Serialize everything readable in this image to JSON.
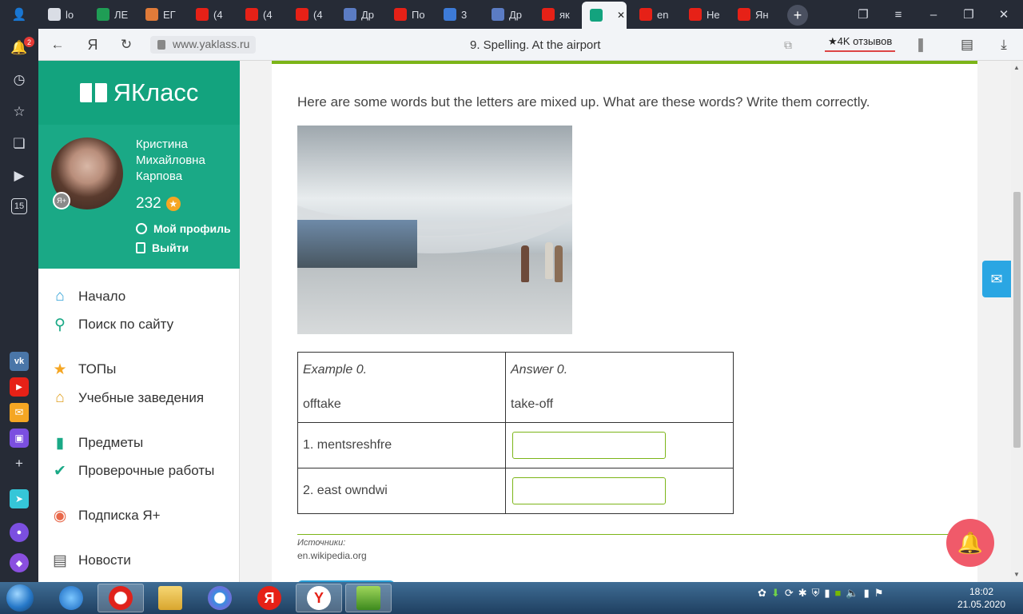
{
  "browser": {
    "tabs": [
      {
        "label": "lo",
        "icon": "document-icon",
        "color": "#d9dde5"
      },
      {
        "label": "ЛЕ",
        "icon": "green-cross-icon",
        "color": "#1f9d55"
      },
      {
        "label": "ЕГ",
        "icon": "basketball-icon",
        "color": "#e07b39"
      },
      {
        "label": "(4",
        "icon": "youtube-icon",
        "color": "#e62117"
      },
      {
        "label": "(4",
        "icon": "youtube-icon",
        "color": "#e62117"
      },
      {
        "label": "(4",
        "icon": "youtube-icon",
        "color": "#e62117"
      },
      {
        "label": "Др",
        "icon": "hand-icon",
        "color": "#5b7cc4"
      },
      {
        "label": "По",
        "icon": "youtube-icon",
        "color": "#e62117"
      },
      {
        "label": "3",
        "icon": "number-icon",
        "color": "#3d7bd8"
      },
      {
        "label": "Др",
        "icon": "hand-icon",
        "color": "#5b7cc4"
      },
      {
        "label": "як",
        "icon": "yandex-icon",
        "color": "#e62117"
      },
      {
        "label": "",
        "icon": "yaklass-icon",
        "color": "#13a37e"
      },
      {
        "label": "en",
        "icon": "yandex-icon",
        "color": "#e62117"
      },
      {
        "label": "Не",
        "icon": "yandex-icon",
        "color": "#e62117"
      },
      {
        "label": "Ян",
        "icon": "translate-icon",
        "color": "#e62117"
      }
    ],
    "url": "www.yaklass.ru",
    "page_title": "9. Spelling. At the airport",
    "reviews": "★4K отзывов",
    "notifications_badge": "2",
    "sidebar_counter": "15"
  },
  "site": {
    "logo": "ЯКласс",
    "user": {
      "first_name": "Кристина",
      "middle_name": "Михайловна",
      "last_name": "Карпова",
      "points": "232",
      "avatar_badge": "Я+"
    },
    "profile_link": "Мой профиль",
    "logout_link": "Выйти",
    "nav": [
      {
        "label": "Начало",
        "icon": "home-icon",
        "color": "#2a9fd6"
      },
      {
        "label": "Поиск по сайту",
        "icon": "search-icon",
        "color": "#1aa986"
      },
      {
        "label": "ТОПы",
        "icon": "star-icon",
        "color": "#f5a623"
      },
      {
        "label": "Учебные заведения",
        "icon": "institution-icon",
        "color": "#e0a020"
      },
      {
        "label": "Предметы",
        "icon": "books-icon",
        "color": "#1aa986"
      },
      {
        "label": "Проверочные работы",
        "icon": "check-circle-icon",
        "color": "#1aa986"
      },
      {
        "label": "Подписка Я+",
        "icon": "subscription-icon",
        "color": "#e8684a"
      },
      {
        "label": "Новости",
        "icon": "news-icon",
        "color": "#555555"
      }
    ]
  },
  "exercise": {
    "instruction": "Here are some words but the letters are mixed up. What are these words? Write them correctly.",
    "example_label": "Example 0.",
    "example_word": "offtake",
    "answer_label": "Answer 0.",
    "answer_word": "take-off",
    "items": [
      {
        "prompt": "1. mentsreshfre",
        "value": ""
      },
      {
        "prompt": "2. east owndwi",
        "value": ""
      }
    ],
    "sources_label": "Источники:",
    "sources_value": "en.wikipedia.org"
  },
  "taskbar": {
    "time": "18:02",
    "date": "21.05.2020"
  },
  "colors": {
    "brand": "#13a37e",
    "accent": "#7cb518",
    "bell": "#f05a6a",
    "mail": "#2aa6e3"
  }
}
